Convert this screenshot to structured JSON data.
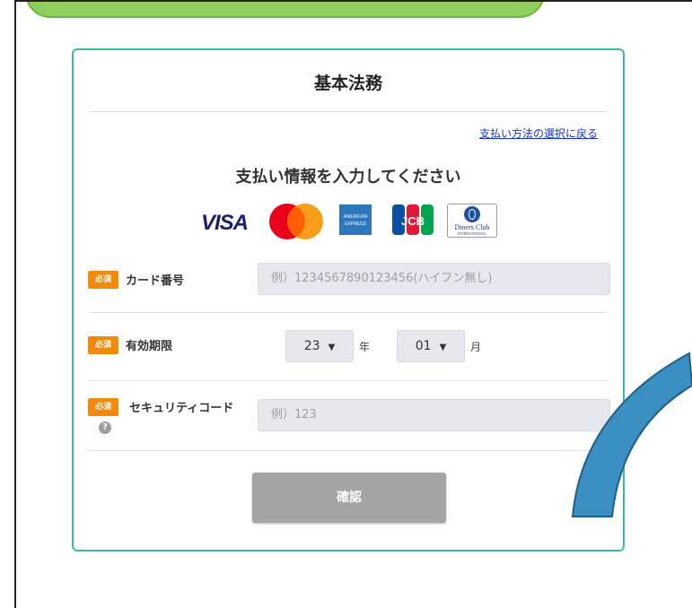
{
  "page": {
    "title": "基本法務",
    "back_link": "支払い方法の選択に戻る",
    "heading": "支払い情報を入力してください"
  },
  "brands": [
    {
      "name": "visa",
      "text": "VISA"
    },
    {
      "name": "mastercard"
    },
    {
      "name": "american-express",
      "line1": "AMERICAN",
      "line2": "EXPRESS"
    },
    {
      "name": "jcb",
      "text": "JCB"
    },
    {
      "name": "diners-club",
      "line1": "Diners Club",
      "line2": "INTERNATIONAL"
    }
  ],
  "form": {
    "required_badge": "必須",
    "card_number": {
      "label": "カード番号",
      "placeholder": "例）1234567890123456(ハイフン無し)"
    },
    "expiry": {
      "label": "有効期限",
      "year_value": "23",
      "year_unit": "年",
      "month_value": "01",
      "month_unit": "月"
    },
    "security_code": {
      "label": "セキュリティコード",
      "placeholder": "例）123",
      "help_icon": "?"
    },
    "confirm_label": "確認"
  },
  "colors": {
    "card_border": "#3fb9a5",
    "required": "#f18a0a",
    "link": "#1a35c4",
    "button_disabled": "#a4a4a4",
    "arrow": "#3c8fc2",
    "banner": "#8ed05f"
  }
}
